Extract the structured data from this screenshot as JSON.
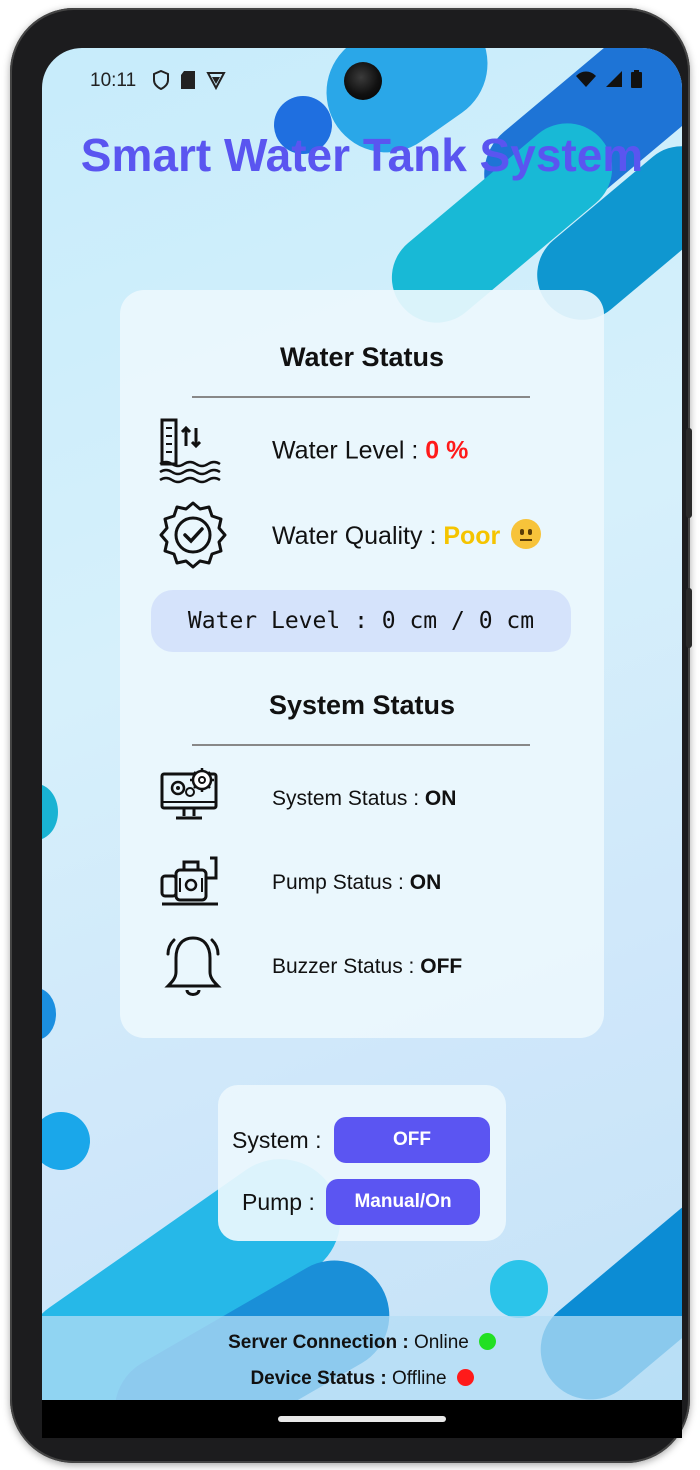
{
  "status_bar": {
    "time": "10:11",
    "left_icons": [
      "shield-icon",
      "sd-card-icon",
      "vpn-icon"
    ],
    "right_icons": [
      "wifi-icon",
      "signal-icon",
      "battery-icon"
    ]
  },
  "app": {
    "title": "Smart Water Tank System",
    "colors": {
      "title": "#5a55f0",
      "accent_button": "#5b55f2",
      "alert": "#ff1a1a",
      "warning": "#f5c400",
      "online": "#22e022",
      "offline": "#ff1a1a"
    }
  },
  "water_status": {
    "heading": "Water Status",
    "level_label": "Water Level : ",
    "level_value": "0 %",
    "quality_label": "Water Quality : ",
    "quality_value": "Poor",
    "quality_emoji": "neutral-face",
    "level_readout": "Water Level : 0 cm / 0 cm"
  },
  "system_status": {
    "heading": "System Status",
    "system_label": "System Status : ",
    "system_value": "ON",
    "pump_label": "Pump Status : ",
    "pump_value": "ON",
    "buzzer_label": "Buzzer Status : ",
    "buzzer_value": "OFF"
  },
  "controls": {
    "system_label": "System :",
    "system_button": "OFF",
    "pump_label": "Pump :",
    "pump_button": "Manual/On"
  },
  "footer": {
    "server_label": "Server Connection :",
    "server_value": " Online",
    "device_label": "Device Status :",
    "device_value": " Offline"
  }
}
